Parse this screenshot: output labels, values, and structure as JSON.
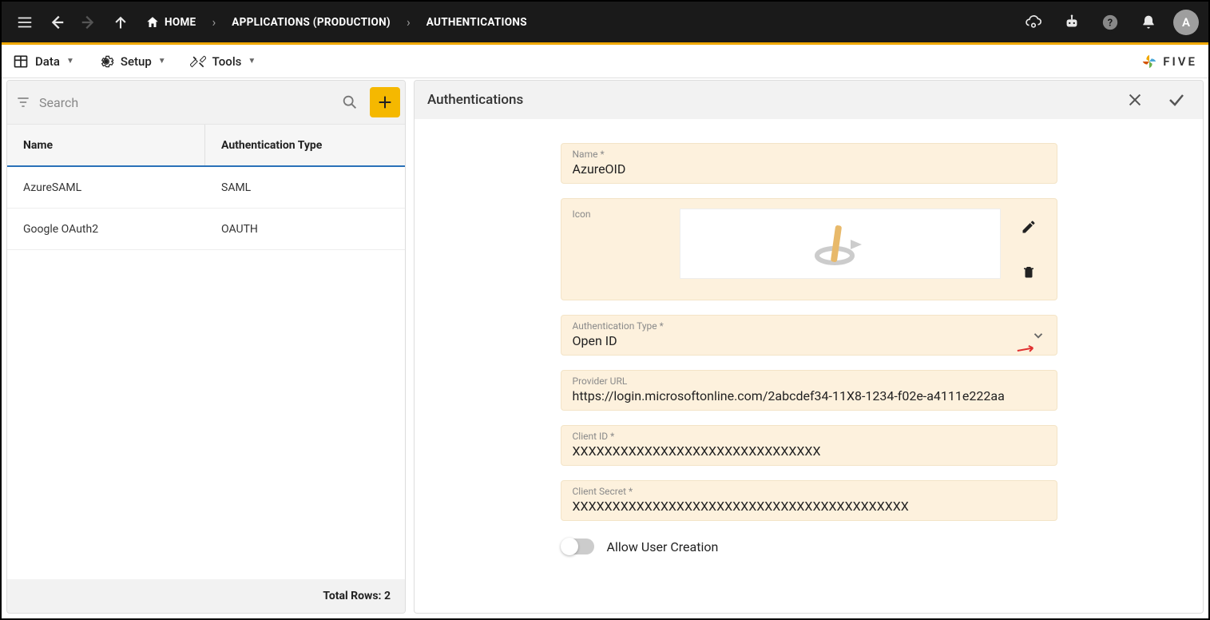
{
  "header": {
    "breadcrumbs": [
      {
        "label": "HOME"
      },
      {
        "label": "APPLICATIONS (PRODUCTION)"
      },
      {
        "label": "AUTHENTICATIONS"
      }
    ],
    "avatar_letter": "A"
  },
  "toolbar": {
    "data_label": "Data",
    "setup_label": "Setup",
    "tools_label": "Tools",
    "brand": "FIVE"
  },
  "left": {
    "search_placeholder": "Search",
    "columns": {
      "name": "Name",
      "type": "Authentication Type"
    },
    "rows": [
      {
        "name": "AzureSAML",
        "type": "SAML"
      },
      {
        "name": "Google OAuth2",
        "type": "OAUTH"
      }
    ],
    "footer_label": "Total Rows:",
    "footer_count": "2"
  },
  "detail": {
    "title": "Authentications",
    "fields": {
      "name_label": "Name *",
      "name_value": "AzureOID",
      "icon_label": "Icon",
      "auth_type_label": "Authentication Type *",
      "auth_type_value": "Open ID",
      "provider_url_label": "Provider URL",
      "provider_url_value": "https://login.microsoftonline.com/2abcdef34-11X8-1234-f02e-a4111e222aa",
      "client_id_label": "Client ID *",
      "client_id_value": "XXXXXXXXXXXXXXXXXXXXXXXXXXXXXXX",
      "client_secret_label": "Client Secret *",
      "client_secret_value": "XXXXXXXXXXXXXXXXXXXXXXXXXXXXXXXXXXXXXXXXXX",
      "allow_user_creation_label": "Allow User Creation"
    }
  }
}
